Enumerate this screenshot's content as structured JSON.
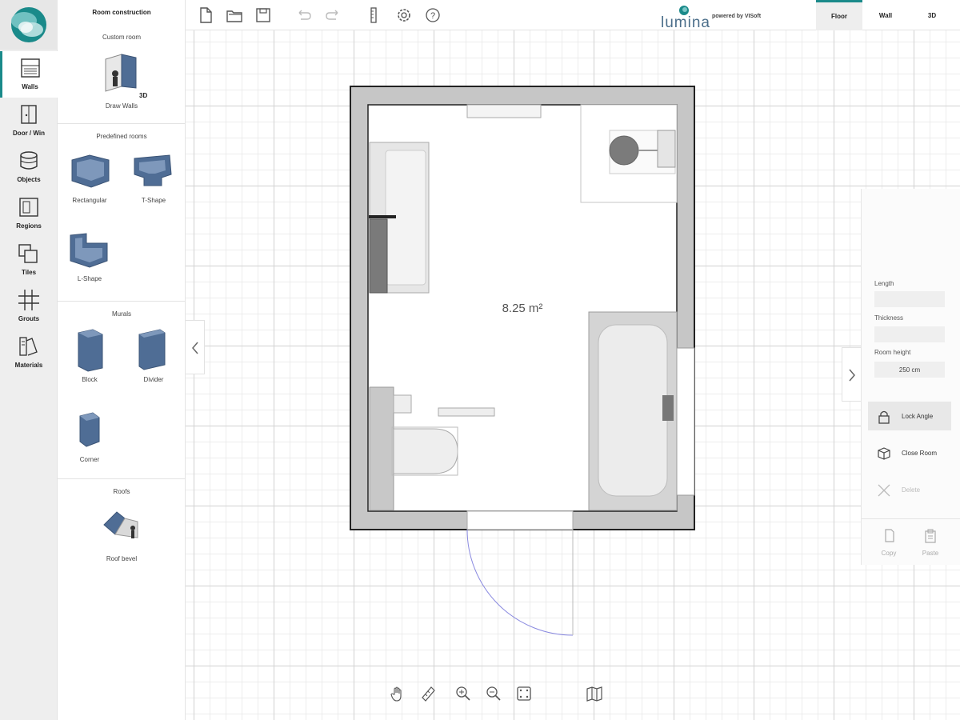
{
  "app": {
    "brand": "lumina",
    "powered_by": "powered by VISoft"
  },
  "rail": {
    "items": [
      {
        "label": "Walls",
        "icon": "walls-icon",
        "active": true
      },
      {
        "label": "Door / Win",
        "icon": "door-window-icon"
      },
      {
        "label": "Objects",
        "icon": "objects-icon"
      },
      {
        "label": "Regions",
        "icon": "regions-icon"
      },
      {
        "label": "Tiles",
        "icon": "tiles-icon"
      },
      {
        "label": "Grouts",
        "icon": "grouts-icon"
      },
      {
        "label": "Materials",
        "icon": "materials-icon"
      }
    ]
  },
  "panel": {
    "title": "Room construction",
    "custom_room": {
      "title": "Custom room",
      "items": [
        {
          "label": "Draw Walls",
          "badge": "3D"
        }
      ]
    },
    "predefined": {
      "title": "Predefined rooms",
      "items": [
        {
          "label": "Rectangular"
        },
        {
          "label": "T-Shape"
        },
        {
          "label": "L-Shape"
        }
      ]
    },
    "murals": {
      "title": "Murals",
      "items": [
        {
          "label": "Block"
        },
        {
          "label": "Divider"
        },
        {
          "label": "Corner"
        }
      ]
    },
    "roofs": {
      "title": "Roofs",
      "items": [
        {
          "label": "Roof bevel"
        }
      ]
    }
  },
  "toolbar": {
    "buttons": [
      "new-file-icon",
      "open-folder-icon",
      "save-icon",
      "undo-icon",
      "redo-icon",
      "measure-icon",
      "settings-icon",
      "help-icon"
    ],
    "view_tabs": [
      {
        "label": "Floor",
        "active": true
      },
      {
        "label": "Wall"
      },
      {
        "label": "3D"
      }
    ]
  },
  "plan": {
    "area_label": "8.25 m²",
    "door_accent": "#8a8ae0"
  },
  "props": {
    "length_label": "Length",
    "length_value": "",
    "thickness_label": "Thickness",
    "thickness_value": "",
    "room_height_label": "Room height",
    "room_height_value": "250 cm",
    "actions": [
      {
        "label": "Lock Angle",
        "icon": "lock-icon",
        "state": "highlighted"
      },
      {
        "label": "Close Room",
        "icon": "cube-icon"
      },
      {
        "label": "Delete",
        "icon": "close-icon",
        "state": "disabled"
      }
    ],
    "copy_label": "Copy",
    "paste_label": "Paste"
  },
  "bottom_tools": [
    "pan-hand-icon",
    "ruler-icon",
    "zoom-in-icon",
    "zoom-out-icon",
    "fit-view-icon",
    "map-icon"
  ],
  "colors": {
    "accent": "#1a8a8a",
    "wall_gray": "#c4c4c4",
    "mural_blue": "#4f6d95"
  }
}
